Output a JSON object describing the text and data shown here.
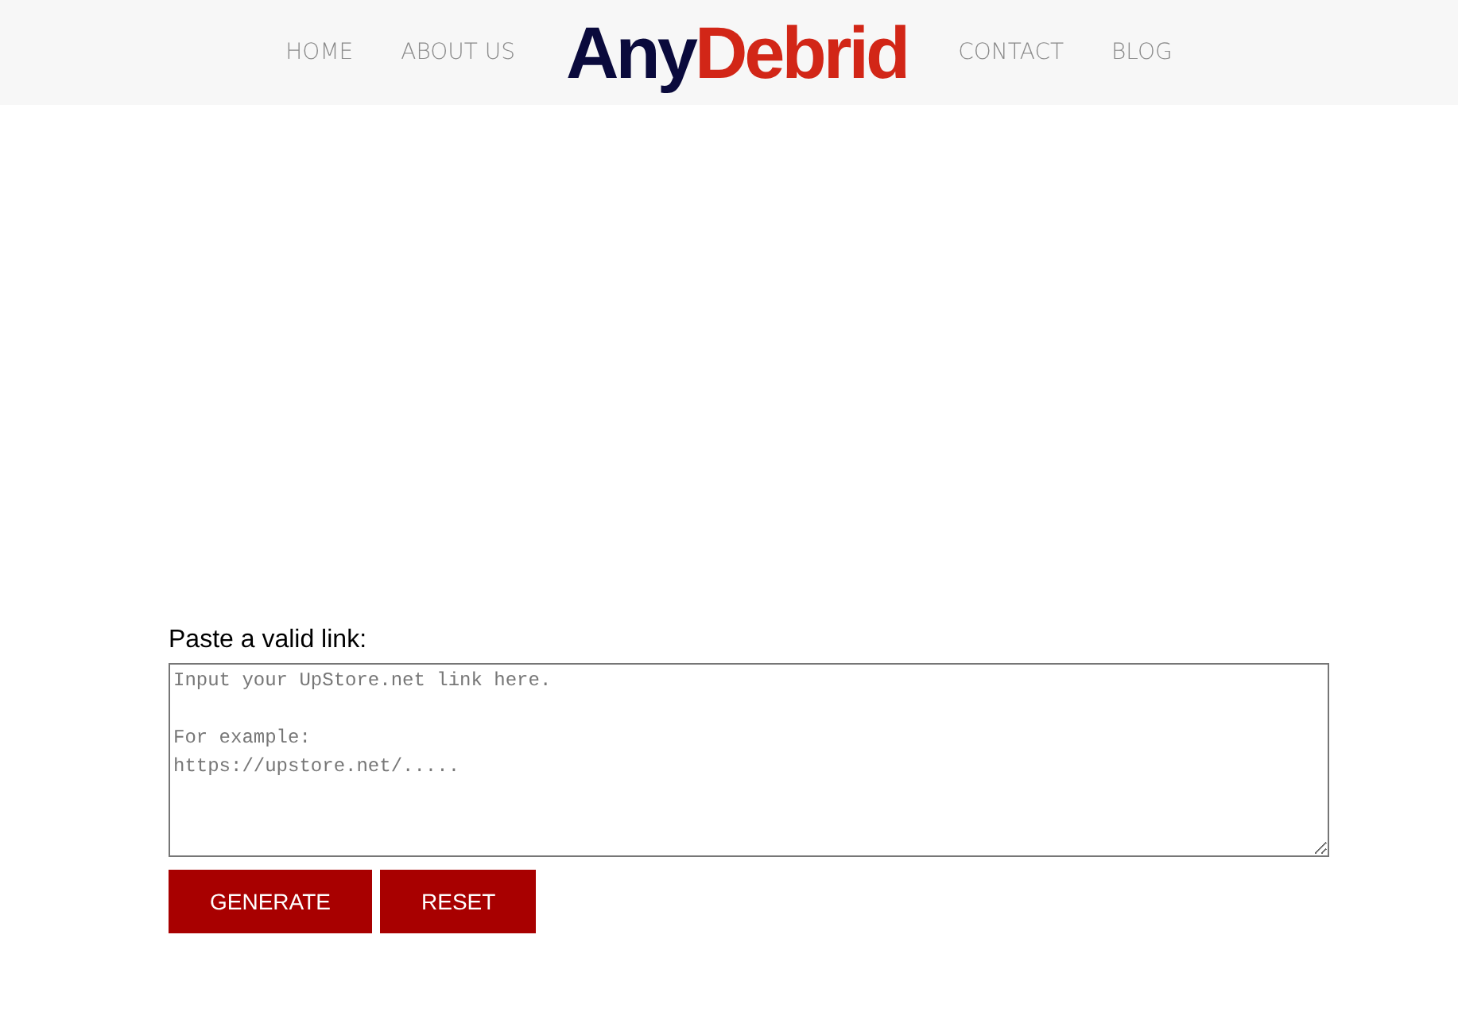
{
  "nav_left": [
    "HOME",
    "ABOUT US"
  ],
  "logo": {
    "first": "Any",
    "second": "Debrid"
  },
  "nav_right": [
    "CONTACT",
    "BLOG"
  ],
  "form": {
    "label": "Paste a valid link:",
    "placeholder": "Input your UpStore.net link here.\n\nFor example:\nhttps://upstore.net/.....",
    "buttons": [
      "GENERATE",
      "RESET"
    ]
  }
}
